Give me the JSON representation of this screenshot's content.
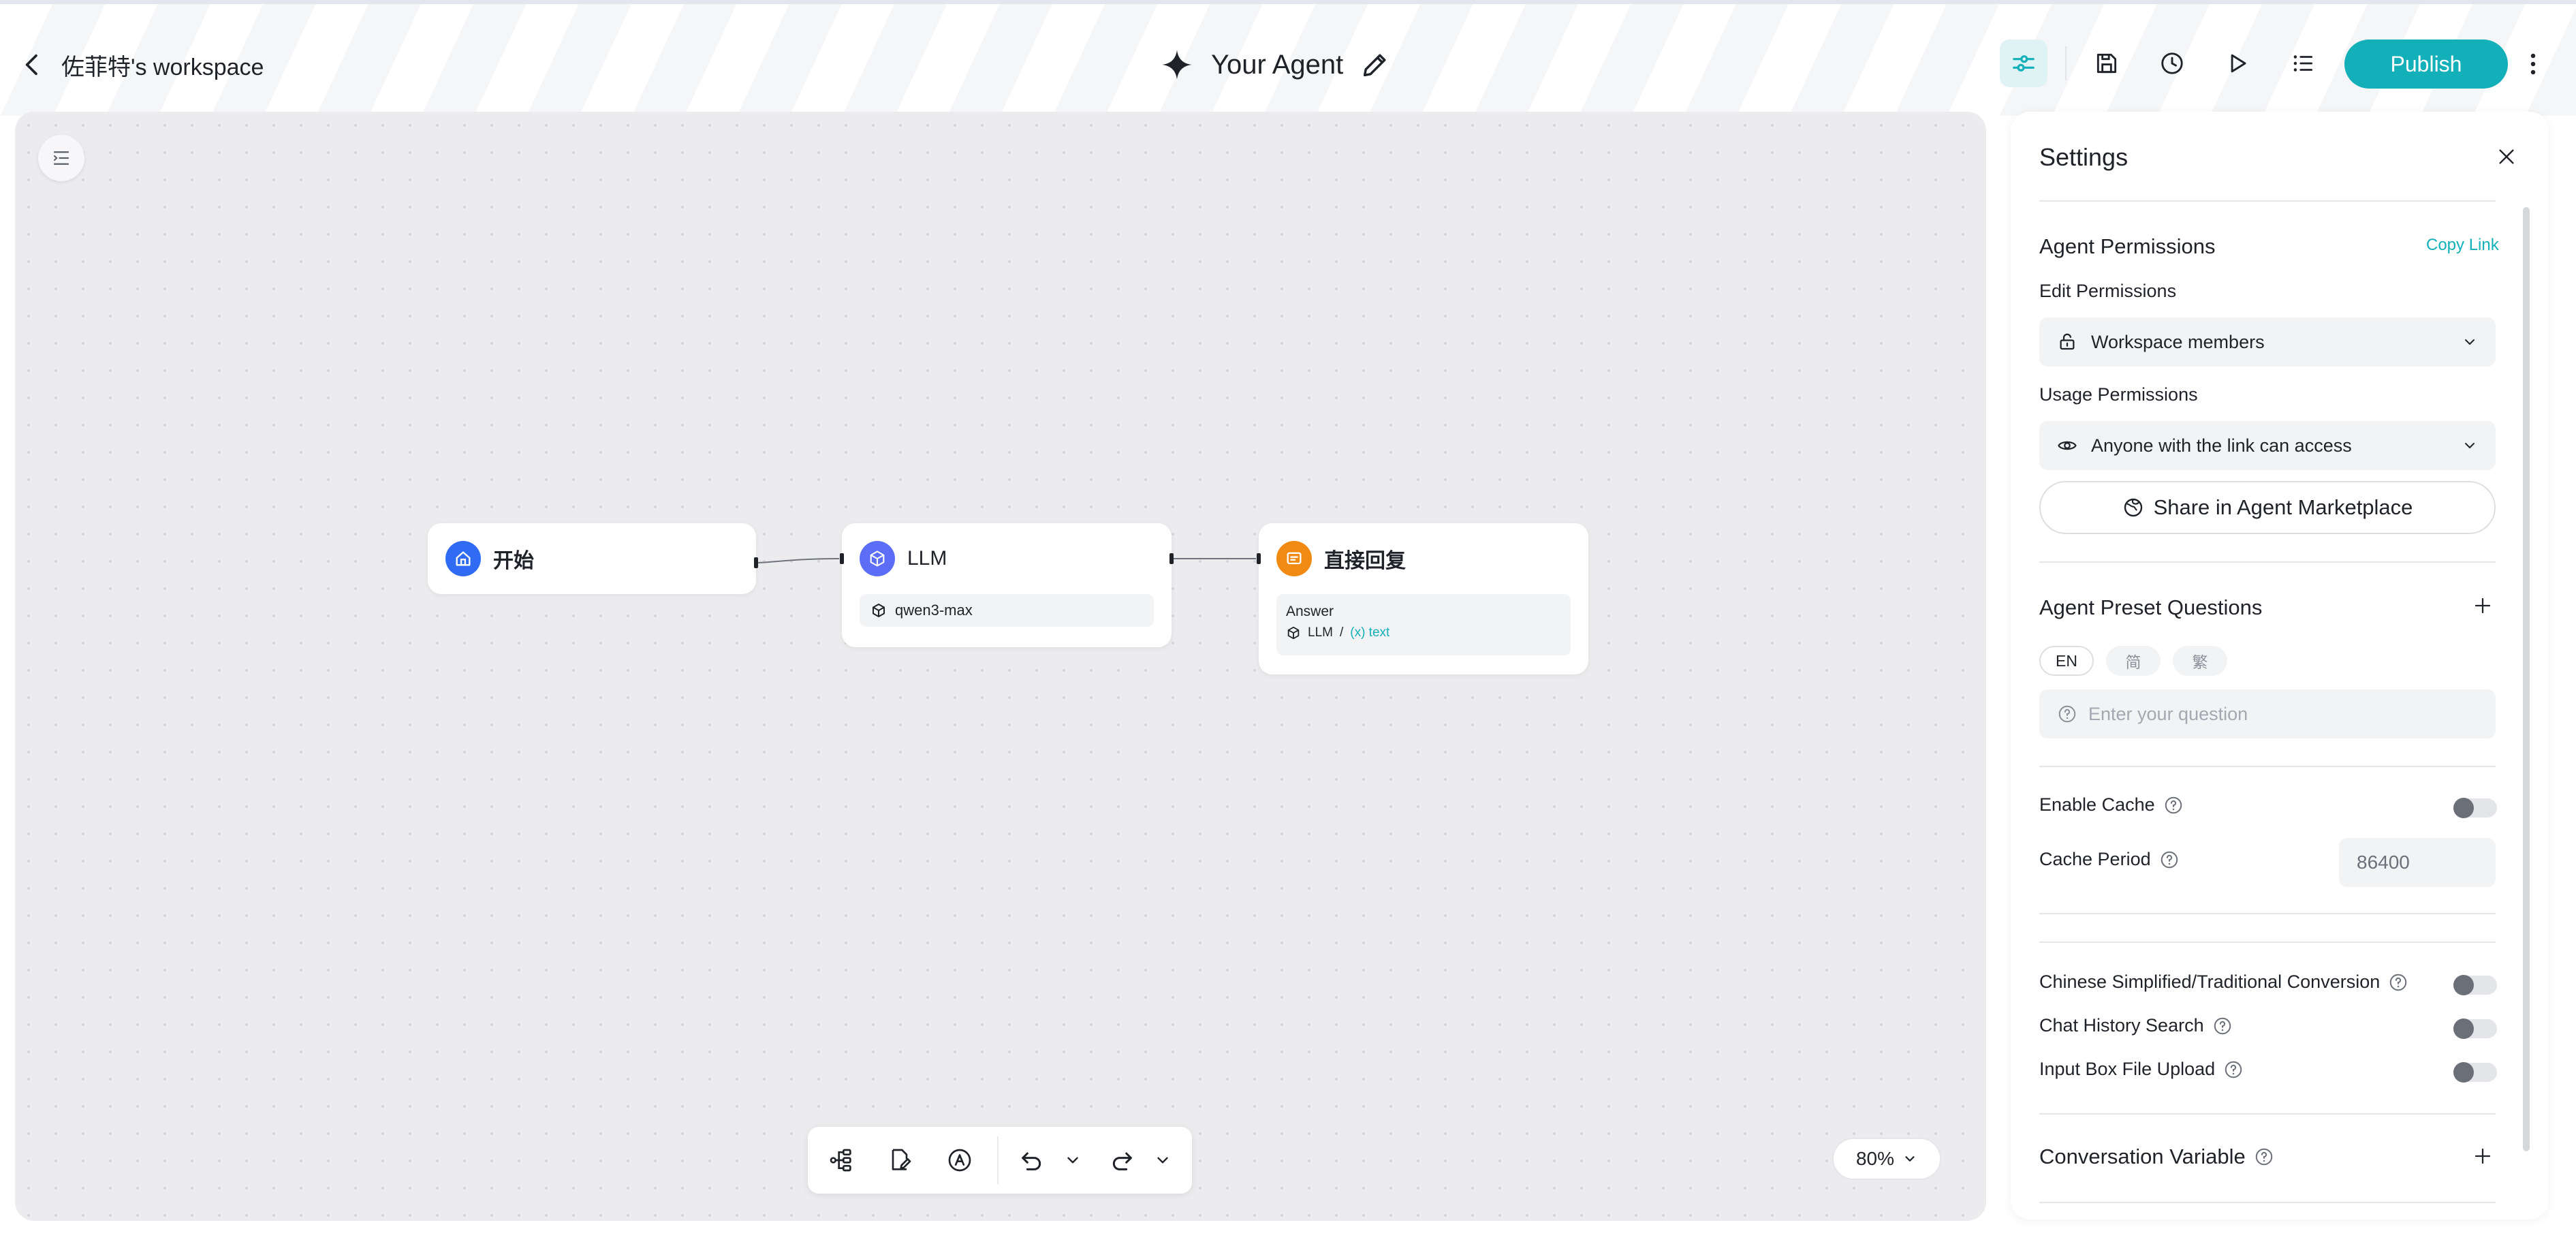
{
  "header": {
    "back_label": "佐菲特's workspace",
    "agent_title": "Your Agent",
    "publish_label": "Publish",
    "icons": [
      "settings-sliders-icon",
      "save-icon",
      "history-icon",
      "run-icon",
      "logs-list-icon",
      "more-vertical-icon"
    ],
    "accent_color": "#13b0b9"
  },
  "canvas": {
    "nodes": {
      "start": {
        "title": "开始",
        "color": "#2f6bf3"
      },
      "llm": {
        "title": "LLM",
        "model": "qwen3-max",
        "color": "#5b6ef5"
      },
      "reply": {
        "title": "直接回复",
        "answer_label": "Answer",
        "ref_source": "LLM",
        "ref_sep": "/",
        "ref_var": "(x) text",
        "color": "#f08a12"
      }
    },
    "zoom_label": "80%"
  },
  "settings": {
    "title": "Settings",
    "agent_permissions": {
      "title": "Agent Permissions",
      "copy_link": "Copy Link",
      "edit_label": "Edit Permissions",
      "edit_value": "Workspace members",
      "usage_label": "Usage Permissions",
      "usage_value": "Anyone with the link can access",
      "share_label": "Share in Agent Marketplace"
    },
    "preset_questions": {
      "title": "Agent Preset Questions",
      "tabs": [
        "EN",
        "简",
        "繁"
      ],
      "active_tab": "EN",
      "placeholder": "Enter your question"
    },
    "cache": {
      "enable_label": "Enable Cache",
      "enable_value": false,
      "period_label": "Cache Period",
      "period_value": "86400"
    },
    "toggles": {
      "conversion_label": "Chinese Simplified/Traditional Conversion",
      "conversion_value": false,
      "history_label": "Chat History Search",
      "history_value": false,
      "upload_label": "Input Box File Upload",
      "upload_value": false
    },
    "conversation_variable": {
      "title": "Conversation Variable"
    }
  }
}
